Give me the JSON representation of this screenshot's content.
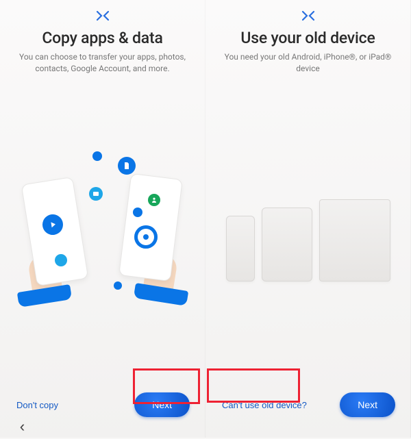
{
  "left": {
    "title": "Copy apps & data",
    "subtitle": "You can choose to transfer your apps, photos, contacts, Google Account, and more.",
    "link": "Don't copy",
    "next": "Next"
  },
  "right": {
    "title": "Use your old device",
    "subtitle": "You need your old Android, iPhone®, or iPad® device",
    "link": "Can't use old device?",
    "next": "Next"
  },
  "colors": {
    "accent": "#1061e0",
    "link": "#1359c4",
    "highlight": "#e23"
  }
}
